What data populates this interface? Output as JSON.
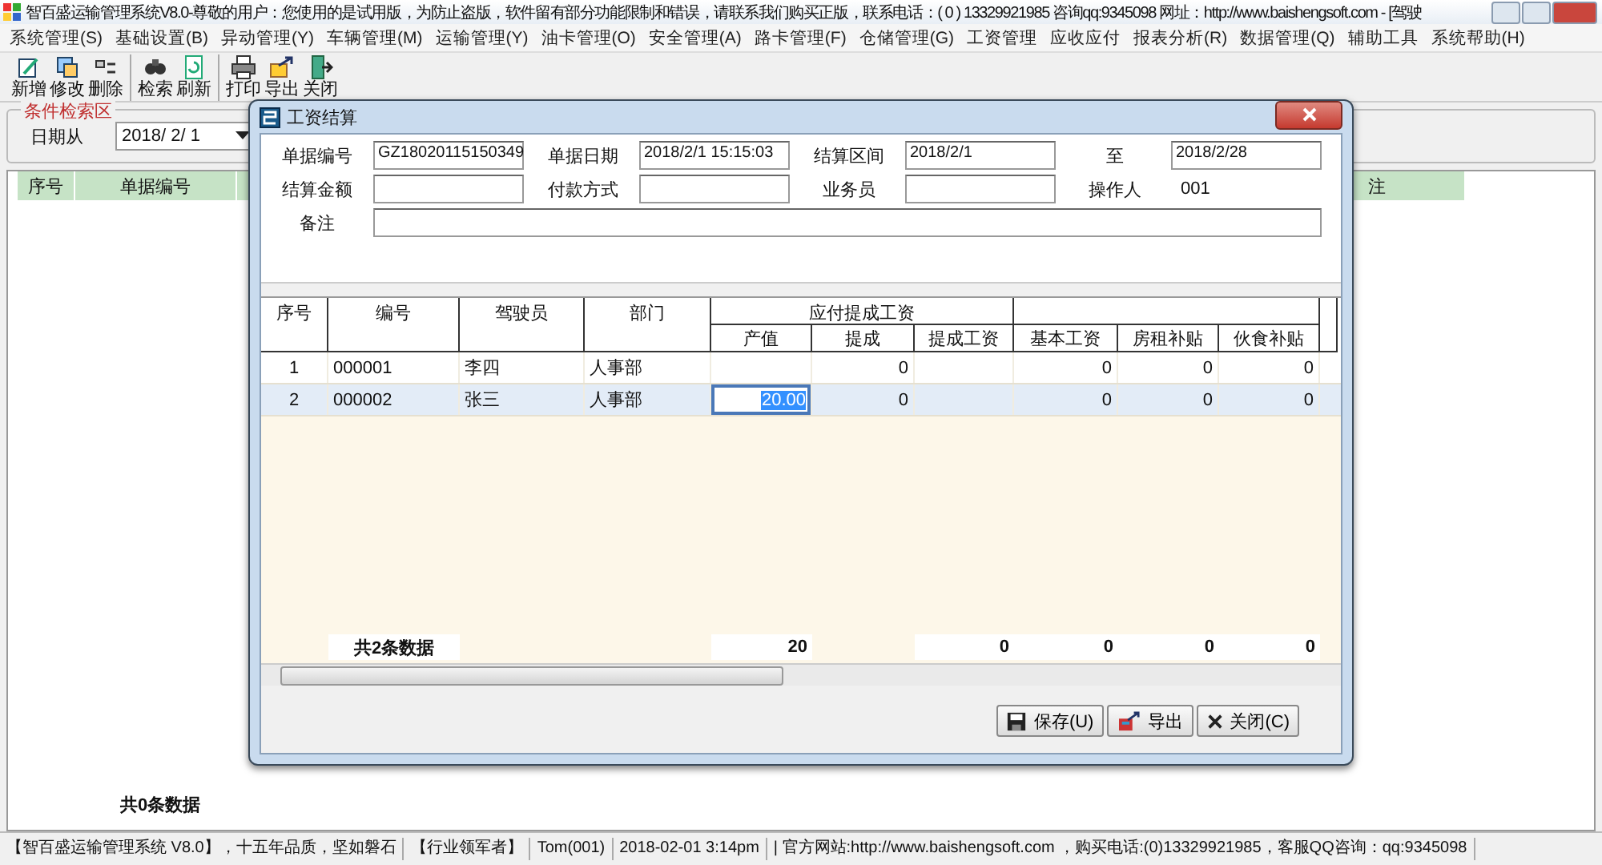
{
  "window": {
    "title": "智百盛运输管理系统V8.0-尊敬的用户：您使用的是试用版，为防止盗版，软件留有部分功能限制和错误，请联系我们购买正版，联系电话：( 0 ) 13329921985  咨询qq:9345098  网址：http://www.baishengsoft.com - [驾驶"
  },
  "menu": [
    {
      "label": "系统管理(S)"
    },
    {
      "label": "基础设置(B)"
    },
    {
      "label": "异动管理(Y)"
    },
    {
      "label": "车辆管理(M)"
    },
    {
      "label": "运输管理(Y)"
    },
    {
      "label": "油卡管理(O)"
    },
    {
      "label": "安全管理(A)"
    },
    {
      "label": "路卡管理(F)"
    },
    {
      "label": "仓储管理(G)"
    },
    {
      "label": "工资管理"
    },
    {
      "label": "应收应付"
    },
    {
      "label": "报表分析(R)"
    },
    {
      "label": "数据管理(Q)"
    },
    {
      "label": "辅助工具"
    },
    {
      "label": "系统帮助(H)"
    }
  ],
  "toolbar": [
    [
      {
        "label": "新增",
        "kind": "add"
      },
      {
        "label": "修改",
        "kind": "edit"
      },
      {
        "label": "删除",
        "kind": "delete"
      }
    ],
    [
      {
        "label": "检索",
        "kind": "search"
      },
      {
        "label": "刷新",
        "kind": "refresh"
      }
    ],
    [
      {
        "label": "打印",
        "kind": "print"
      },
      {
        "label": "导出",
        "kind": "export"
      },
      {
        "label": "关闭",
        "kind": "exit"
      }
    ]
  ],
  "search": {
    "title": "条件检索区",
    "label": "日期从",
    "date": "2018/ 2/ 1"
  },
  "main_table": {
    "columns": [
      "序号",
      "单据编号",
      "注"
    ],
    "summary": "共0条数据"
  },
  "dialog": {
    "title": "工资结算",
    "fields": [
      [
        {
          "label": "单据编号",
          "value": "GZ18020115150349",
          "kind": "input"
        },
        {
          "label": "单据日期",
          "value": "2018/2/1 15:15:03",
          "kind": "input"
        },
        {
          "label": "结算区间",
          "value": "2018/2/1",
          "kind": "input"
        },
        {
          "label": "至",
          "value": "2018/2/28",
          "kind": "input"
        }
      ],
      [
        {
          "label": "结算金额",
          "kind": "input"
        },
        {
          "label": "付款方式",
          "kind": "input"
        },
        {
          "label": "业务员",
          "kind": "input"
        },
        {
          "label": "操作人",
          "value": "001",
          "kind": "text"
        }
      ],
      [
        {
          "label": "备注",
          "kind": "wide"
        }
      ]
    ],
    "grid": {
      "columns": [
        {
          "label": "序号",
          "kind": "single"
        },
        {
          "label": "编号",
          "kind": "single"
        },
        {
          "label": "驾驶员",
          "kind": "single"
        },
        {
          "label": "部门",
          "kind": "single"
        },
        {
          "label": "产值",
          "kind": "group_start",
          "group": "应付提成工资"
        },
        {
          "label": "提成",
          "kind": "grouped"
        },
        {
          "label": "提成工资",
          "kind": "grouped"
        },
        {
          "label": "基本工资",
          "kind": "group_start"
        },
        {
          "label": "房租补贴",
          "kind": "grouped"
        },
        {
          "label": "伙食补贴",
          "kind": "grouped"
        }
      ],
      "rows": [
        {
          "kind": "data",
          "selected": false,
          "cells": [
            {
              "text": "1",
              "editing": false
            },
            {
              "text": "000001",
              "editing": false
            },
            {
              "text": "李四",
              "editing": false
            },
            {
              "text": "人事部",
              "editing": false
            },
            {
              "editing": false
            },
            {
              "text": "0",
              "editing": false
            },
            {
              "editing": false
            },
            {
              "text": "0",
              "editing": false
            },
            {
              "text": "0",
              "editing": false
            },
            {
              "text": "0",
              "editing": false
            }
          ]
        },
        {
          "kind": "data",
          "selected": true,
          "cells": [
            {
              "text": "2",
              "editing": false
            },
            {
              "text": "000002",
              "editing": false
            },
            {
              "text": "张三",
              "editing": false
            },
            {
              "text": "人事部",
              "editing": false
            },
            {
              "text": "20.00",
              "editing": true
            },
            {
              "text": "0",
              "editing": false
            },
            {
              "editing": false
            },
            {
              "text": "0",
              "editing": false
            },
            {
              "text": "0",
              "editing": false
            },
            {
              "text": "0",
              "editing": false
            }
          ]
        },
        {
          "kind": "total",
          "selected": false,
          "cells": [
            {
              "editing": false
            },
            {
              "text": "共2条数据",
              "editing": false
            },
            {
              "editing": false
            },
            {
              "editing": false
            },
            {
              "text": "20",
              "editing": false
            },
            {
              "editing": false
            },
            {
              "text": "0",
              "editing": false
            },
            {
              "text": "0",
              "editing": false
            },
            {
              "text": "0",
              "editing": false
            },
            {
              "text": "0",
              "editing": false
            }
          ]
        }
      ]
    },
    "buttons": [
      {
        "label": "保存(U)",
        "kind": "save"
      },
      {
        "label": "导出",
        "kind": "export"
      },
      {
        "label": "关闭(C)",
        "kind": "close"
      }
    ]
  },
  "status_bar": [
    "【智百盛运输管理系统 V8.0】，十五年品质，坚如磐石",
    "【行业领军者】",
    "Tom(001)",
    "2018-02-01 3:14pm",
    "|  官方网站:http://www.baishengsoft.com ，购买电话:(0)13329921985，客服QQ咨询：qq:9345098"
  ]
}
